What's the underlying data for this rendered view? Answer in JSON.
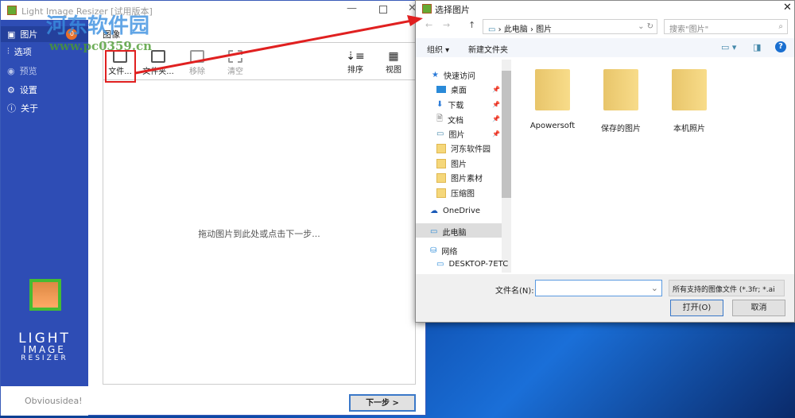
{
  "app": {
    "title": "Light Image Resizer  [试用版本]",
    "section_title": "图像",
    "drop_hint": "拖动图片到此处或点击下一步...",
    "next_button": "下一步 >",
    "brand_line1": "LIGHT",
    "brand_line2": "IMAGE",
    "brand_line3": "RESIZER",
    "vendor": "Obviousidea!",
    "badge": "0"
  },
  "sidebar": {
    "items": [
      {
        "label": "图片",
        "icon": "image-icon"
      },
      {
        "label": "选项",
        "icon": "sliders-icon"
      },
      {
        "label": "预览",
        "icon": "eye-icon"
      },
      {
        "label": "设置",
        "icon": "gear-icon"
      },
      {
        "label": "关于",
        "icon": "info-icon"
      }
    ]
  },
  "toolbar": {
    "files": "文件...",
    "folder": "文件夹...",
    "remove": "移除",
    "clear": "清空",
    "sort": "排序",
    "view": "视图"
  },
  "watermark": {
    "name": "河东软件园",
    "url": "www.pc0359.cn"
  },
  "dialog": {
    "title": "选择图片",
    "breadcrumb": [
      "此电脑",
      "图片"
    ],
    "search_placeholder": "搜索\"图片\"",
    "organize": "组织 ▾",
    "new_folder": "新建文件夹",
    "nav": [
      "快速访问",
      "桌面",
      "下载",
      "文档",
      "图片",
      "河东软件园",
      "图片",
      "图片素材",
      "压缩图",
      "OneDrive",
      "此电脑",
      "网络",
      "DESKTOP-7ETC"
    ],
    "folders": [
      "Apowersoft",
      "保存的图片",
      "本机照片"
    ],
    "filename_label": "文件名(N):",
    "filename_value": "",
    "filetype": "所有支持的图像文件 (*.3fr; *.ai",
    "open": "打开(O)",
    "cancel": "取消"
  },
  "colors": {
    "sidebar": "#2e4db5",
    "highlight": "#e02020",
    "accent": "#0078d7"
  }
}
